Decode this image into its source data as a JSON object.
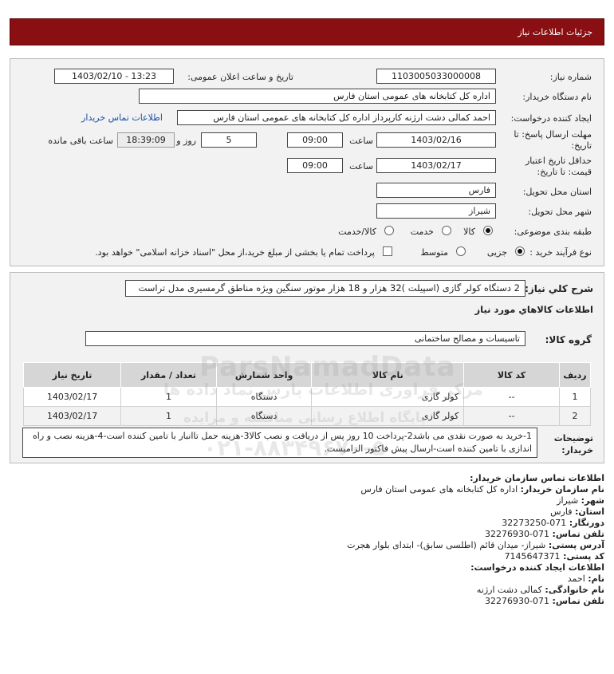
{
  "header": {
    "title": "جزئیات اطلاعات نیاز"
  },
  "form": {
    "need_number_label": "شماره نیاز:",
    "need_number": "1103005033000008",
    "announce_label": "تاریخ و ساعت اعلان عمومی:",
    "announce_value": "1403/02/10 - 13:23",
    "buyer_label": "نام دستگاه خریدار:",
    "buyer_value": "اداره کل کتابخانه های عمومی استان فارس",
    "creator_label": "ایجاد کننده درخواست:",
    "creator_value": "احمد  کمالی دشت ارژنه  کارپرداز اداره کل کتابخانه های عمومی استان فارس",
    "contact_link": "اطلاعات تماس خریدار",
    "deadline_label": "مهلت ارسال پاسخ: تا تاریخ:",
    "deadline_date": "1403/02/16",
    "time_label": "ساعت",
    "deadline_time": "09:00",
    "days_value": "5",
    "days_label": "روز و",
    "remaining_time": "18:39:09",
    "remaining_label": "ساعت باقی مانده",
    "validity_label": "حداقل تاریخ اعتبار قیمت: تا تاریخ:",
    "validity_date": "1403/02/17",
    "validity_time": "09:00",
    "province_label": "استان محل تحویل:",
    "province_value": "فارس",
    "city_label": "شهر محل تحویل:",
    "city_value": "شیراز",
    "category_label": "طبقه بندی موضوعی:",
    "category_options": [
      "کالا",
      "خدمت",
      "کالا/خدمت"
    ],
    "category_selected": "کالا",
    "process_label": "نوع فرآیند خرید :",
    "process_options": [
      "جزیی",
      "متوسط"
    ],
    "process_selected": "جزیی",
    "payment_note": "پرداخت تمام یا بخشی از مبلغ خرید،از محل \"اسناد خزانه اسلامی\" خواهد بود."
  },
  "details": {
    "summary_label": "شرح کلي نياز:",
    "summary_value": "2 دستگاه کولر گازی (اسپیلت )32 هزار و 18 هزار موتور سنگین ویژه مناطق گرمسیری مدل تراست",
    "goods_info_title": "اطلاعات کالاهاي مورد نياز",
    "group_label": "گروه کالا:",
    "group_value": "تاسیسات و مصالح ساختمانی",
    "table": {
      "headers": [
        "ردیف",
        "کد کالا",
        "نام کالا",
        "واحد شمارش",
        "تعداد / مقدار",
        "تاریخ نیاز"
      ],
      "rows": [
        [
          "1",
          "--",
          "کولر گازی",
          "دستگاه",
          "1",
          "1403/02/17"
        ],
        [
          "2",
          "--",
          "کولر گازی",
          "دستگاه",
          "1",
          "1403/02/17"
        ]
      ]
    },
    "notes_label": "توضیحات خریدار:",
    "notes_value": "1-خرید به صورت نقدی می باشد2-پرداخت 10 روز پس از دریافت و نصب کالا3-هزینه حمل تاانبار با تامین کننده است-4-هزینه نصب و راه اندازی با تامین کننده است-ارسال پیش فاکتور الزامیست."
  },
  "buyer_contact": {
    "title": "اطلاعات تماس سازمان خریدار:",
    "org_label": "نام سازمان خریدار:",
    "org_value": "اداره کل کتابخانه های عمومی استان فارس",
    "city_label": "شهر:",
    "city_value": "شیراز",
    "province_label": "استان:",
    "province_value": "فارس",
    "fax_label": "دورنگار:",
    "fax_value": "071-32273250",
    "phone_label": "تلفن تماس:",
    "phone_value": "071-32276930",
    "address_label": "آدرس پستی:",
    "address_value": "شیراز- میدان قائم (اطلسی سابق)- ابتدای بلوار هجرت",
    "postal_label": "کد پستی:",
    "postal_value": "7145647371"
  },
  "creator_contact": {
    "title": "اطلاعات ایجاد کننده درخواست:",
    "name_label": "نام:",
    "name_value": "احمد",
    "family_label": "نام خانوادگی:",
    "family_value": "کمالی دشت ارژنه",
    "phone_label": "تلفن تماس:",
    "phone_value": "071-32276930"
  },
  "watermark": {
    "brand": "ParsNamadData",
    "line1": "مرکز فراوری اطلاعات پارس نماد داده ها",
    "line2": "پایگاه اطلاع رسانی مناقصه و مزایده",
    "phone": "۰۲۱-۸۸۳۴۹۶۷۰-۵"
  }
}
